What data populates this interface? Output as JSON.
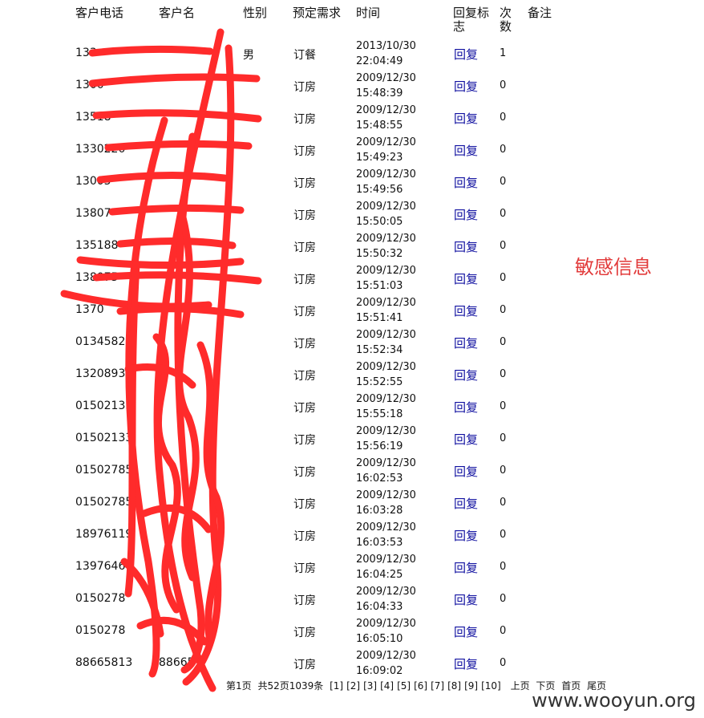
{
  "headers": {
    "phone": "客户电话",
    "name": "客户名",
    "gender": "性别",
    "need": "预定需求",
    "time": "时间",
    "reply_flag": "回复标志",
    "count": "次数",
    "remark": "备注"
  },
  "rows": [
    {
      "phone": "133",
      "name": "",
      "gender": "男",
      "need": "订餐",
      "date": "2013/10/30",
      "clock": "22:04:49",
      "reply": "回复",
      "count": "1"
    },
    {
      "phone": "1300",
      "name": "",
      "gender": "",
      "need": "订房",
      "date": "2009/12/30",
      "clock": "15:48:39",
      "reply": "回复",
      "count": "0"
    },
    {
      "phone": "13518",
      "name": "",
      "gender": "",
      "need": "订房",
      "date": "2009/12/30",
      "clock": "15:48:55",
      "reply": "回复",
      "count": "0"
    },
    {
      "phone": "1330220",
      "name": "",
      "gender": "",
      "need": "订房",
      "date": "2009/12/30",
      "clock": "15:49:23",
      "reply": "回复",
      "count": "0"
    },
    {
      "phone": "13005",
      "name": "",
      "gender": "",
      "need": "订房",
      "date": "2009/12/30",
      "clock": "15:49:56",
      "reply": "回复",
      "count": "0"
    },
    {
      "phone": "13807",
      "name": "",
      "gender": "",
      "need": "订房",
      "date": "2009/12/30",
      "clock": "15:50:05",
      "reply": "回复",
      "count": "0"
    },
    {
      "phone": "135188",
      "name": "",
      "gender": "",
      "need": "订房",
      "date": "2009/12/30",
      "clock": "15:50:32",
      "reply": "回复",
      "count": "0"
    },
    {
      "phone": "138075",
      "name": "",
      "gender": "",
      "need": "订房",
      "date": "2009/12/30",
      "clock": "15:51:03",
      "reply": "回复",
      "count": "0"
    },
    {
      "phone": "1370",
      "name": "",
      "gender": "",
      "need": "订房",
      "date": "2009/12/30",
      "clock": "15:51:41",
      "reply": "回复",
      "count": "0"
    },
    {
      "phone": "0134582",
      "name": "",
      "gender": "",
      "need": "订房",
      "date": "2009/12/30",
      "clock": "15:52:34",
      "reply": "回复",
      "count": "0"
    },
    {
      "phone": "13208931",
      "name": "",
      "gender": "",
      "need": "订房",
      "date": "2009/12/30",
      "clock": "15:52:55",
      "reply": "回复",
      "count": "0"
    },
    {
      "phone": "01502133",
      "name": "",
      "gender": "",
      "need": "订房",
      "date": "2009/12/30",
      "clock": "15:55:18",
      "reply": "回复",
      "count": "0"
    },
    {
      "phone": "01502133",
      "name": "",
      "gender": "",
      "need": "订房",
      "date": "2009/12/30",
      "clock": "15:56:19",
      "reply": "回复",
      "count": "0"
    },
    {
      "phone": "01502785",
      "name": "",
      "gender": "",
      "need": "订房",
      "date": "2009/12/30",
      "clock": "16:02:53",
      "reply": "回复",
      "count": "0"
    },
    {
      "phone": "01502785",
      "name": "",
      "gender": "",
      "need": "订房",
      "date": "2009/12/30",
      "clock": "16:03:28",
      "reply": "回复",
      "count": "0"
    },
    {
      "phone": "18976119",
      "name": "",
      "gender": "",
      "need": "订房",
      "date": "2009/12/30",
      "clock": "16:03:53",
      "reply": "回复",
      "count": "0"
    },
    {
      "phone": "1397646",
      "name": "",
      "gender": "",
      "need": "订房",
      "date": "2009/12/30",
      "clock": "16:04:25",
      "reply": "回复",
      "count": "0"
    },
    {
      "phone": "0150278",
      "name": "",
      "gender": "",
      "need": "订房",
      "date": "2009/12/30",
      "clock": "16:04:33",
      "reply": "回复",
      "count": "0"
    },
    {
      "phone": "0150278",
      "name": "",
      "gender": "",
      "need": "订房",
      "date": "2009/12/30",
      "clock": "16:05:10",
      "reply": "回复",
      "count": "0"
    },
    {
      "phone": "88665813",
      "name": "88665",
      "gender": "",
      "need": "订房",
      "date": "2009/12/30",
      "clock": "16:09:02",
      "reply": "回复",
      "count": "0"
    }
  ],
  "annotation": "敏感信息",
  "pager": {
    "current": "第1页",
    "summary": "共52页1039条",
    "pages": [
      "[1]",
      "[2]",
      "[3]",
      "[4]",
      "[5]",
      "[6]",
      "[7]",
      "[8]",
      "[9]",
      "[10]"
    ],
    "prev": "上页",
    "next": "下页",
    "first": "首页",
    "last": "尾页"
  },
  "watermark": "www.wooyun.org",
  "colors": {
    "redaction": "#ff2b2b",
    "link": "#1010a0",
    "annotation": "#e23b3b"
  }
}
